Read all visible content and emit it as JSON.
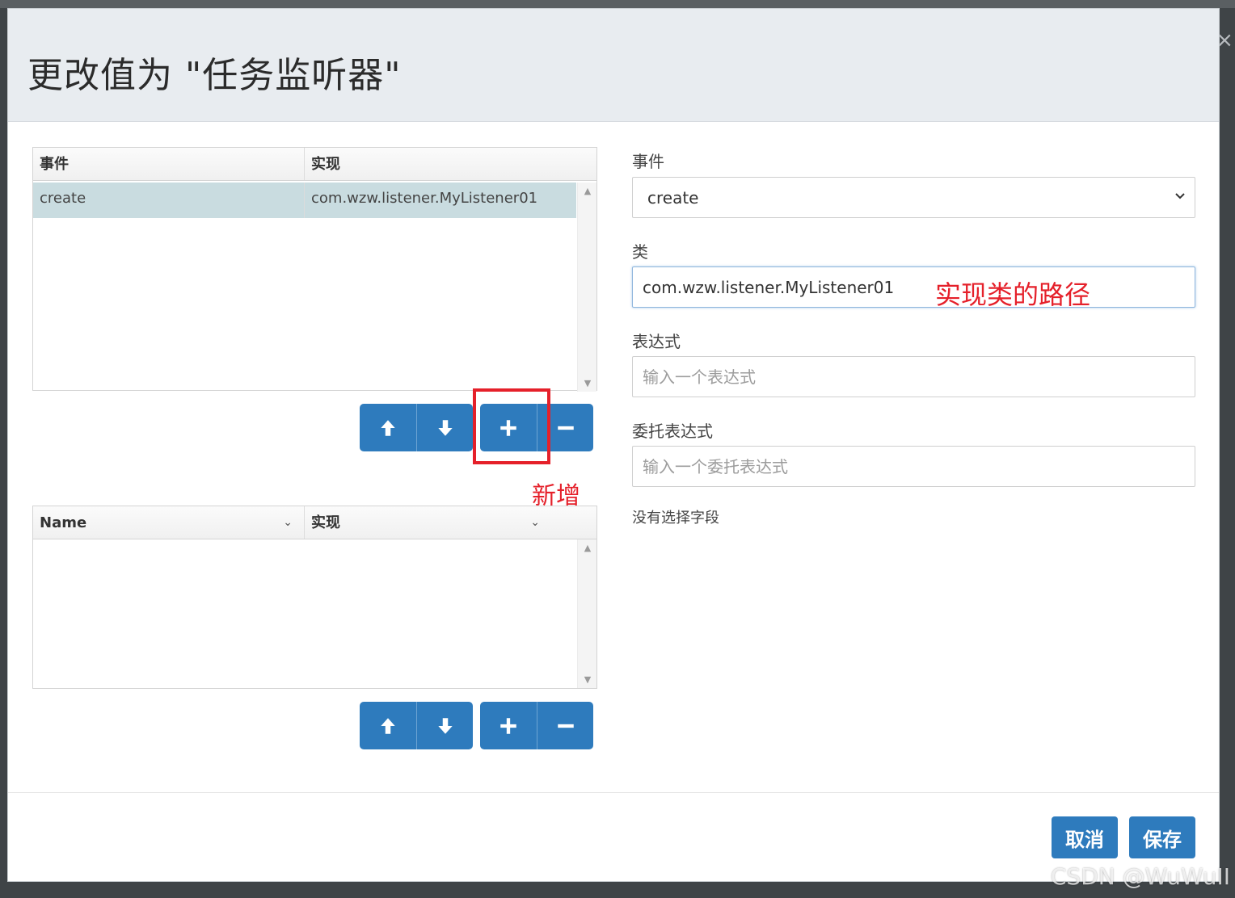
{
  "dialog": {
    "title": "更改值为 \"任务监听器\"",
    "close_glyph": "×"
  },
  "listener_grid": {
    "columns": [
      "事件",
      "实现"
    ],
    "rows": [
      {
        "event": "create",
        "implementation": "com.wzw.listener.MyListener01",
        "selected": true
      }
    ]
  },
  "listener_buttons": {
    "move_up": "move-up",
    "move_down": "move-down",
    "add": "add",
    "remove": "remove"
  },
  "field_grid": {
    "columns": [
      "Name",
      "实现"
    ],
    "rows": []
  },
  "annotations": {
    "add_label": "新增",
    "path_label": "实现类的路径",
    "highlight_color": "#e5202a"
  },
  "form": {
    "event_label": "事件",
    "event_value": "create",
    "class_label": "类",
    "class_value": "com.wzw.listener.MyListener01",
    "expression_label": "表达式",
    "expression_placeholder": "输入一个表达式",
    "delegate_label": "委托表达式",
    "delegate_placeholder": "输入一个委托表达式",
    "no_field_text": "没有选择字段"
  },
  "footer": {
    "cancel_label": "取消",
    "save_label": "保存"
  },
  "watermark": "CSDN @WuWuII",
  "colors": {
    "primary": "#2e7bbd",
    "header_bg": "#e8ecf0",
    "selected_row": "#c9dce0"
  }
}
